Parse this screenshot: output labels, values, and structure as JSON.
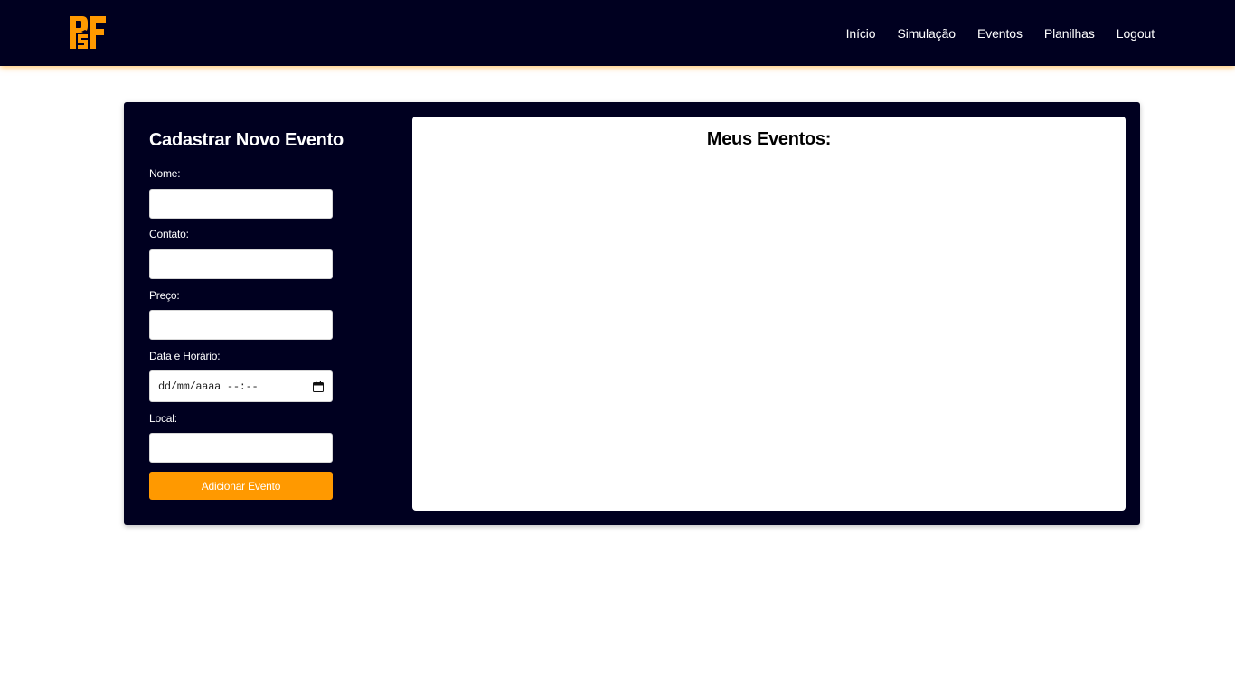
{
  "navbar": {
    "logo_text": "PsF",
    "links": [
      "Início",
      "Simulação",
      "Eventos",
      "Planilhas",
      "Logout"
    ]
  },
  "form": {
    "title": "Cadastrar Novo Evento",
    "fields": {
      "name_label": "Nome:",
      "contact_label": "Contato:",
      "price_label": "Preço:",
      "datetime_label": "Data e Horário:",
      "datetime_placeholder": "dd/mm/aaaa --:--",
      "location_label": "Local:"
    },
    "submit_label": "Adicionar Evento"
  },
  "events": {
    "title": "Meus Eventos:"
  },
  "colors": {
    "navy": "#000020",
    "accent": "#ff9900",
    "white": "#ffffff"
  }
}
